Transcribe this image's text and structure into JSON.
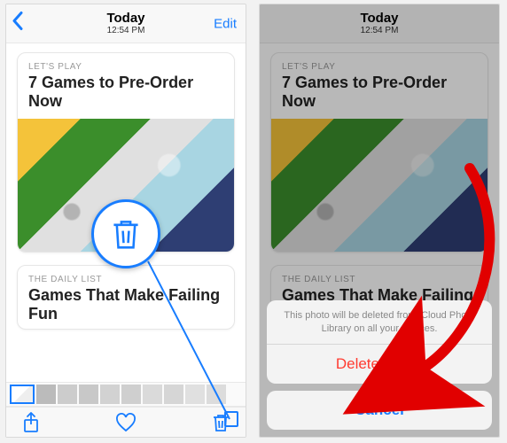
{
  "header": {
    "title": "Today",
    "subtitle": "12:54 PM",
    "back_icon": "chevron-back",
    "edit_label": "Edit"
  },
  "cards": [
    {
      "kicker": "LET'S PLAY",
      "headline": "7 Games to Pre-Order Now"
    },
    {
      "kicker": "THE DAILY LIST",
      "headline": "Games That Make Failing Fun"
    }
  ],
  "toolbar": {
    "share_icon": "share",
    "favorite_icon": "heart",
    "trash_icon": "trash"
  },
  "callout": {
    "icon": "trash"
  },
  "action_sheet": {
    "message": "This photo will be deleted from iCloud Photo Library on all your devices.",
    "delete_label": "Delete Photo",
    "cancel_label": "Cancel"
  },
  "colors": {
    "accent": "#187dff",
    "destructive": "#ff3b30"
  }
}
